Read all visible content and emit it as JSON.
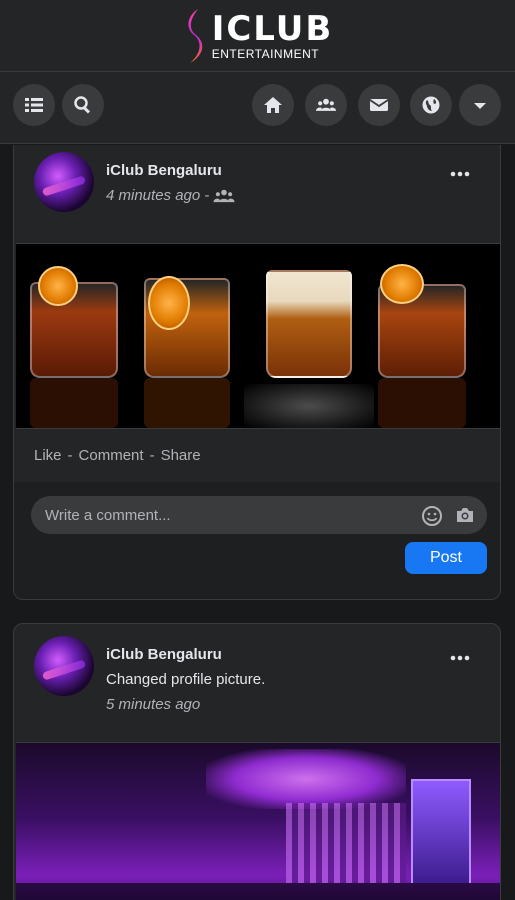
{
  "brand": {
    "name": "ICLUB",
    "tagline": "ENTERTAINMENT"
  },
  "nav": {
    "left": [
      "menu-icon",
      "search-icon"
    ],
    "right": [
      "home-icon",
      "groups-icon",
      "mail-icon",
      "globe-icon",
      "caret-down-icon"
    ]
  },
  "posts": [
    {
      "author": "iClub Bengaluru",
      "time": "4 minutes ago",
      "separator": "-",
      "audience_icon": "friends-icon",
      "actions": {
        "like": "Like",
        "comment": "Comment",
        "share": "Share",
        "sep": "-"
      },
      "comment": {
        "placeholder": "Write a comment...",
        "post_label": "Post"
      }
    },
    {
      "author": "iClub Bengaluru",
      "status": "Changed profile picture.",
      "time": "5 minutes ago"
    }
  ],
  "colors": {
    "background": "#18191a",
    "surface": "#242526",
    "accent": "#1877f2",
    "muted": "#b0b3b8"
  }
}
